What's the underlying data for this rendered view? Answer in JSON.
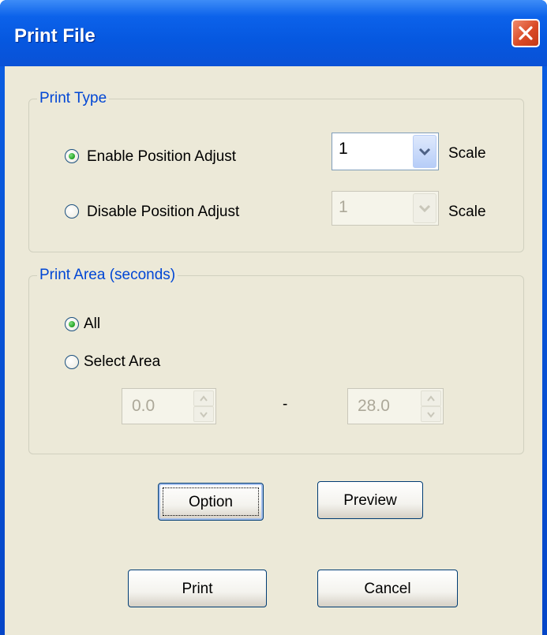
{
  "window": {
    "title": "Print File",
    "close_icon": "close-icon"
  },
  "print_type": {
    "legend": "Print Type",
    "enable_label": "Enable Position Adjust",
    "enable_scale_value": "1",
    "disable_label": "Disable Position Adjust",
    "disable_scale_value": "1",
    "scale_label": "Scale",
    "selected": "enable"
  },
  "print_area": {
    "legend": "Print Area (seconds)",
    "all_label": "All",
    "select_label": "Select Area",
    "selected": "all",
    "from_value": "0.0",
    "separator": "-",
    "to_value": "28.0"
  },
  "buttons": {
    "option": "Option",
    "preview": "Preview",
    "print": "Print",
    "cancel": "Cancel"
  },
  "colors": {
    "accent": "#0046d5",
    "titlebar": "#0658e0",
    "face": "#ece9d8",
    "close": "#d94a26"
  }
}
